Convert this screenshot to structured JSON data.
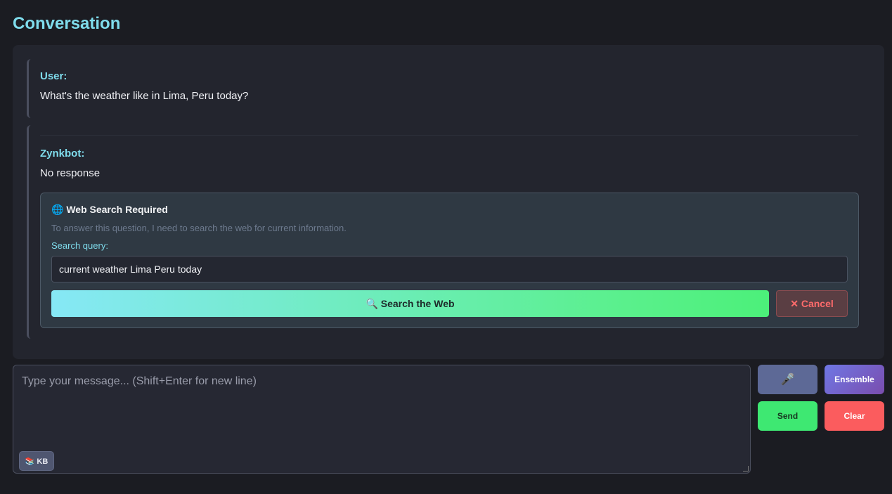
{
  "page": {
    "title": "Conversation"
  },
  "conversation": {
    "messages": [
      {
        "sender": "User:",
        "text": "What's the weather like in Lima, Peru today?"
      },
      {
        "sender": "Zynkbot:",
        "text": "No response"
      }
    ],
    "web_search": {
      "icon": "globe-icon",
      "icon_glyph": "🌐",
      "title": "Web Search Required",
      "description": "To answer this question, I need to search the web for current information.",
      "query_label": "Search query:",
      "query_value": "current weather Lima Peru today",
      "search_button": "🔍 Search the Web",
      "cancel_button": "✕ Cancel"
    }
  },
  "composer": {
    "placeholder": "Type your message... (Shift+Enter for new line)",
    "kb_button": "📚 KB",
    "mic_button": "🎤",
    "ensemble_button": "Ensemble",
    "send_button": "Send",
    "clear_button": "Clear"
  },
  "colors": {
    "background": "#1b1c22",
    "accent": "#7fdcec",
    "search_gradient_start": "#86e8f6",
    "search_gradient_end": "#4cf07a",
    "send": "#3ee872",
    "clear": "#fb5c5e",
    "ensemble_start": "#6f77e4",
    "ensemble_end": "#7a4dae"
  }
}
